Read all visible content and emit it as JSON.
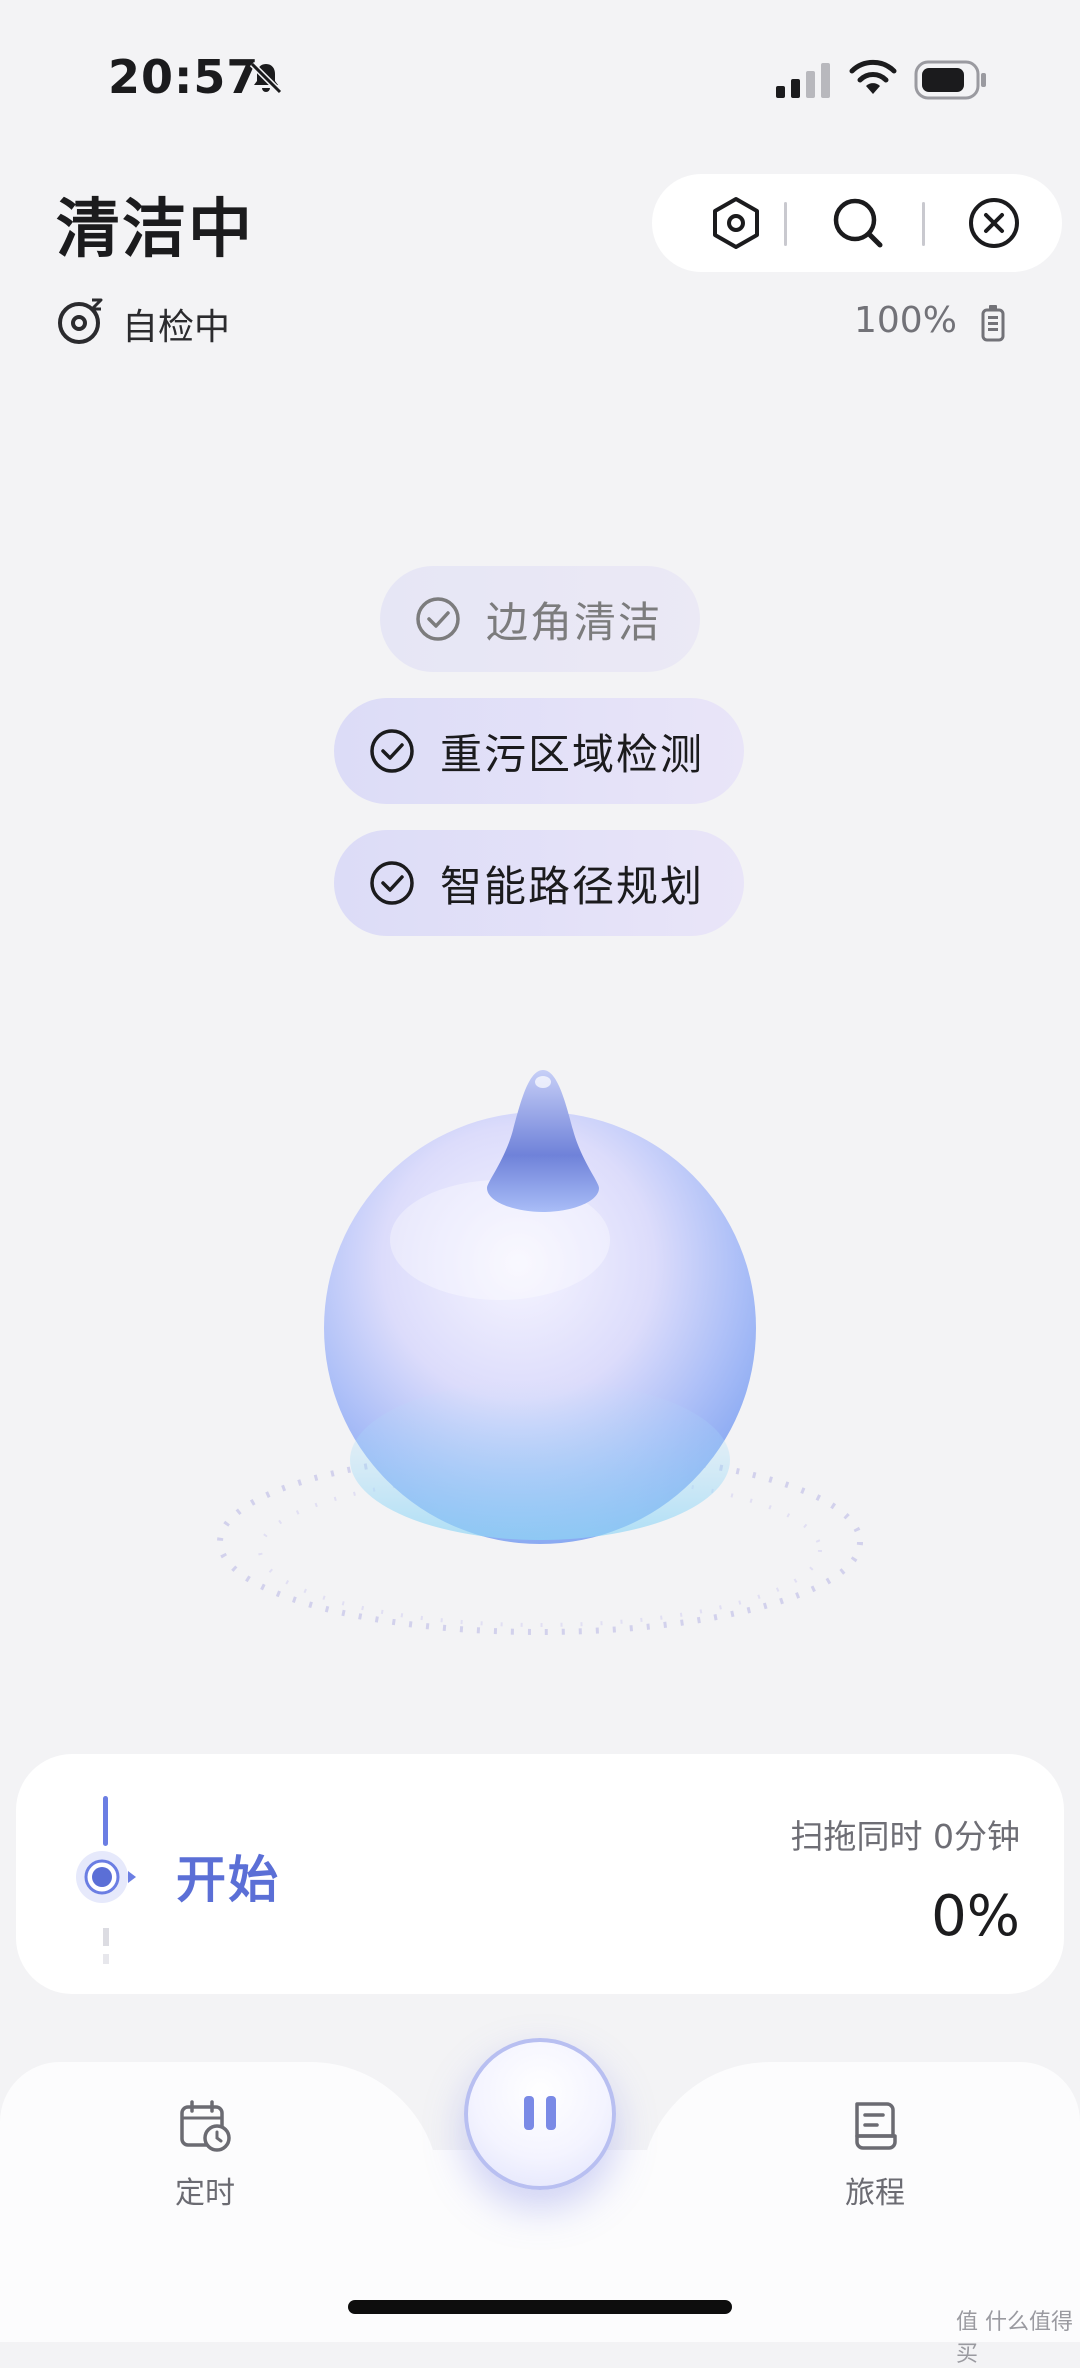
{
  "status_bar": {
    "time": "20:57",
    "icons": [
      "bell-off-icon",
      "cellular-signal-icon",
      "wifi-icon",
      "battery-icon"
    ]
  },
  "header": {
    "title": "清洁中",
    "status_text": "自检中",
    "status_icon": "self-check-icon",
    "battery_percent": "100%",
    "battery_icon": "battery-full-icon"
  },
  "toolbar": {
    "icons": [
      "settings-hex-icon",
      "search-icon",
      "close-circle-icon"
    ]
  },
  "checks": [
    {
      "label": "边角清洁",
      "done": true
    },
    {
      "label": "重污区域检测",
      "done": true
    },
    {
      "label": "智能路径规划",
      "done": true
    }
  ],
  "progress_card": {
    "stage": "开始",
    "caption": "扫拖同时 0分钟",
    "percent": "0%",
    "progress": 0
  },
  "bottom_nav": {
    "schedule_label": "定时",
    "schedule_icon": "calendar-clock-icon",
    "history_label": "旅程",
    "history_icon": "document-icon",
    "pause_icon": "pause-icon"
  },
  "watermark": "值 什么值得买",
  "colors": {
    "accent": "#5b6fd6",
    "background": "#f3f3f5",
    "droplet": "#a9bdf7"
  }
}
